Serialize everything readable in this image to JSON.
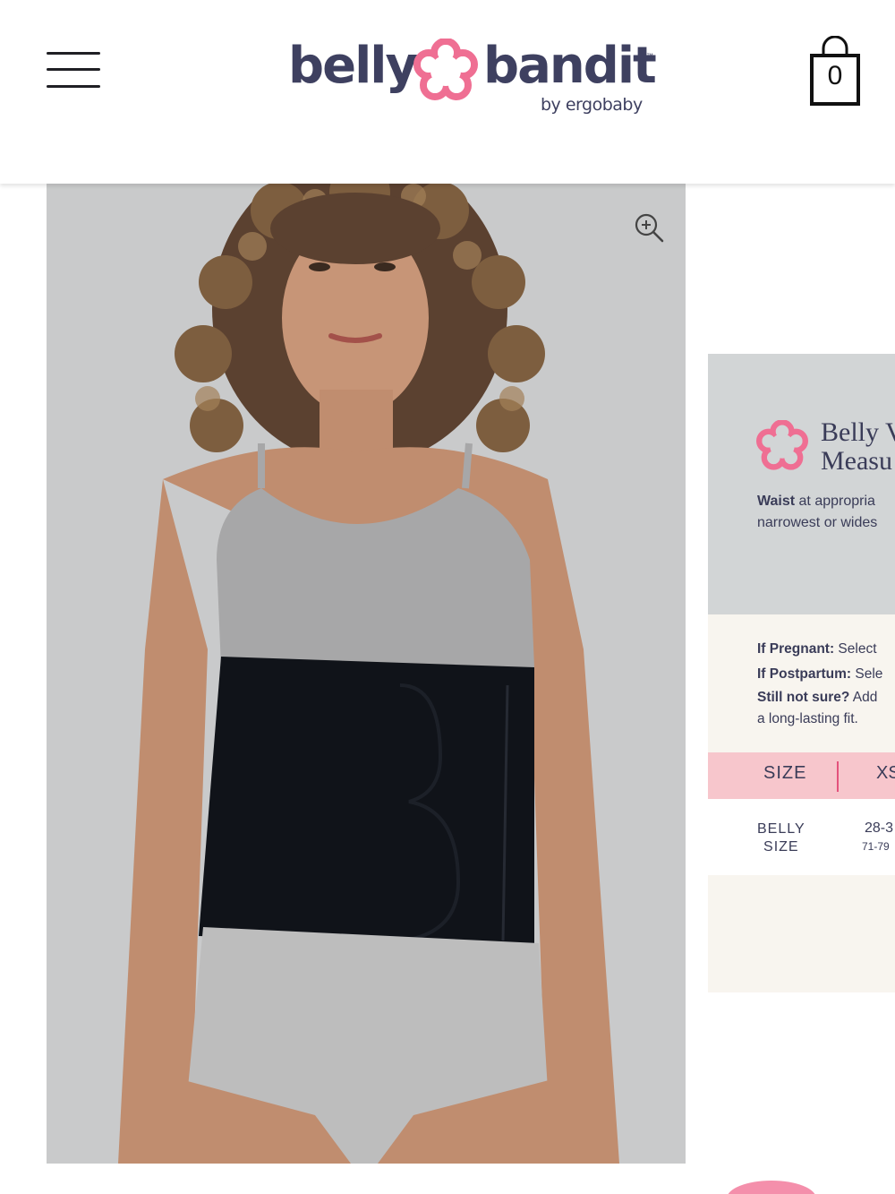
{
  "header": {
    "logo_word_1": "belly",
    "logo_word_2": "bandit",
    "logo_tm": "™",
    "logo_sub": "by ergobaby",
    "cart_count": "0"
  },
  "colors": {
    "brand_navy": "#3e4060",
    "brand_pink": "#ef6f93",
    "image_bg": "#c9cacb",
    "chart_grey": "#d2d5d6",
    "chart_cream": "#f8f5ef",
    "chart_pink": "#f7c6cc"
  },
  "icons": {
    "menu": "hamburger-menu-icon",
    "cart": "shopping-bag-icon",
    "zoom": "zoom-in-icon",
    "flower": "flower-logo-icon"
  },
  "size_chart": {
    "title_line_1": "Belly V",
    "title_line_2": "Measu",
    "waist_bold": "Waist",
    "waist_line_1_rest": " at appropria",
    "waist_line_2": "narrowest or wides",
    "note_1_bold": "If Pregnant:",
    "note_1_rest": " Select",
    "note_2_bold": "If Postpartum:",
    "note_2_rest": " Sele",
    "note_3_bold": "Still not sure?",
    "note_3_rest": " Add",
    "note_4": "a long-lasting fit.",
    "size_header": "SIZE",
    "size_first": "XS",
    "belly_label_1": "BELLY",
    "belly_label_2": "SIZE",
    "belly_inches": "28-3",
    "belly_cm": "71-79"
  }
}
